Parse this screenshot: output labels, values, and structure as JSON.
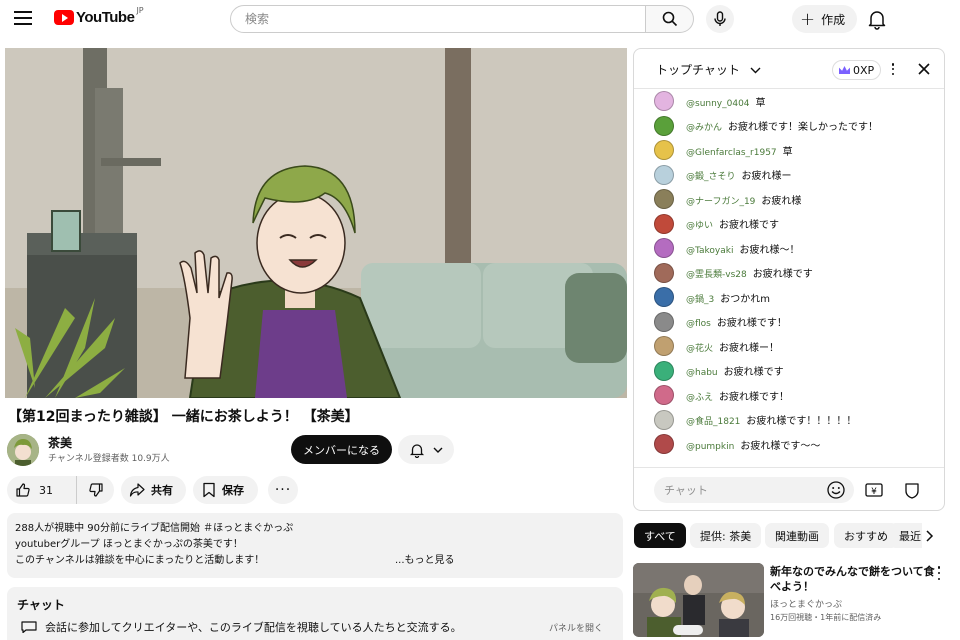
{
  "header": {
    "logo_text": "YouTube",
    "logo_region": "JP",
    "search_placeholder": "検索",
    "create_label": "作成"
  },
  "video": {
    "title": "【第12回まったり雑談】 一緒にお茶しよう！ 【茶美】",
    "channel_name": "茶美",
    "subscribers": "チャンネル登録者数 10.9万人",
    "member_label": "メンバーになる",
    "like_count": "31",
    "share_label": "共有",
    "save_label": "保存",
    "more_label": "···"
  },
  "description": {
    "line1": "288人が視聴中  90分前にライブ配信開始  ＃ほっとまぐかっぷ",
    "line2": "youtuberグループ ほっとまぐかっぷの茶美です！",
    "line3": "このチャンネルは雑談を中心にまったりと活動します！",
    "more": "...もっと見る"
  },
  "chat_section": {
    "heading": "チャット",
    "message": "会話に参加してクリエイターや、このライブ配信を視聴している人たちと交流する。",
    "open_panel": "パネルを開く"
  },
  "live_chat": {
    "title": "トップチャット",
    "xp_badge": "0XP",
    "input_placeholder": "チャット",
    "messages": [
      {
        "author": "@sunny_0404",
        "text": "草",
        "avatar_color": "#e3b4e0"
      },
      {
        "author": "@みかん",
        "text": "お疲れ様です！楽しかったです！",
        "avatar_color": "#5aa03a"
      },
      {
        "author": "@Glenfarclas_r1957",
        "text": "草",
        "avatar_color": "#e6c24a"
      },
      {
        "author": "@鍛_さそり",
        "text": "お疲れ様ー",
        "avatar_color": "#b8d0dc"
      },
      {
        "author": "@ナーフガン_19",
        "text": "お疲れ様",
        "avatar_color": "#8a7f5a"
      },
      {
        "author": "@ゆい",
        "text": "お疲れ様です",
        "avatar_color": "#c04a3a"
      },
      {
        "author": "@Takoyaki",
        "text": "お疲れ様～！",
        "avatar_color": "#b46cc0"
      },
      {
        "author": "@霊長類-vs28",
        "text": "お疲れ様です",
        "avatar_color": "#a06a5a"
      },
      {
        "author": "@鍋_3",
        "text": "おつかれm",
        "avatar_color": "#3a6ea8"
      },
      {
        "author": "@flos",
        "text": "お疲れ様です！",
        "avatar_color": "#8a8a8a"
      },
      {
        "author": "@花火",
        "text": "お疲れ様ー！",
        "avatar_color": "#c0a070"
      },
      {
        "author": "@habu",
        "text": "お疲れ様です",
        "avatar_color": "#3ab07a"
      },
      {
        "author": "@ふえ",
        "text": "お疲れ様です！",
        "avatar_color": "#d06a8a"
      },
      {
        "author": "@食品_1821",
        "text": "お疲れ様です！！！！！",
        "avatar_color": "#c8c8c0"
      },
      {
        "author": "@pumpkin",
        "text": "お疲れ様です～～",
        "avatar_color": "#b04a4a"
      }
    ]
  },
  "chips": [
    "すべて",
    "提供: 茶美",
    "関連動画",
    "おすすめ",
    "最近"
  ],
  "recommended": {
    "title": "新年なのでみんなで餅をついて食べよう！",
    "channel": "ほっとまぐかっぷ",
    "meta": "16万回視聴・1年前に配信済み"
  },
  "colors": {
    "brand_red": "#ff0000",
    "author_green": "#4a7a3a",
    "member_button": "#0f0f0f"
  }
}
